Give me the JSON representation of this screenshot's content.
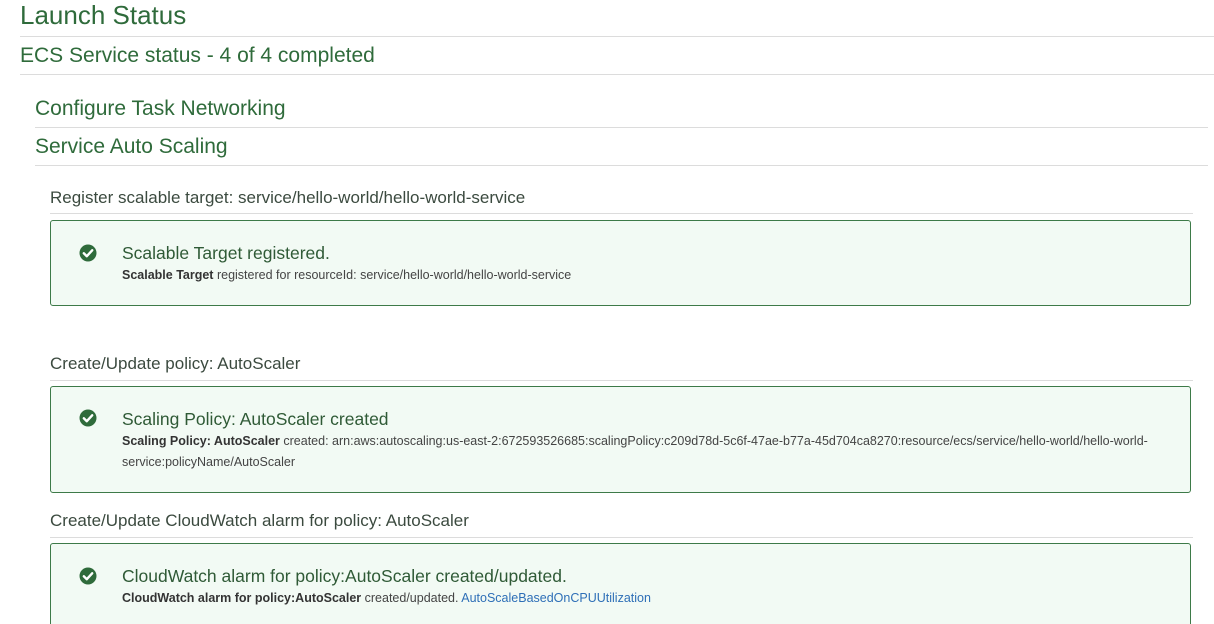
{
  "page": {
    "title": "Launch Status",
    "ecs_status": "ECS Service status - 4 of 4 completed"
  },
  "sections": {
    "configure_networking": "Configure Task Networking",
    "auto_scaling": "Service Auto Scaling"
  },
  "steps": [
    {
      "heading": "Register scalable target: service/hello-world/hello-world-service",
      "icon": "check-circle-icon",
      "title": "Scalable Target registered.",
      "detail_bold": "Scalable Target",
      "detail_text": " registered for resourceId: service/hello-world/hello-world-service"
    },
    {
      "heading": "Create/Update policy: AutoScaler",
      "icon": "check-circle-icon",
      "title": "Scaling Policy: AutoScaler created",
      "detail_bold": "Scaling Policy: AutoScaler",
      "detail_text": " created: arn:aws:autoscaling:us-east-2:672593526685:scalingPolicy:c209d78d-5c6f-47ae-b77a-45d704ca8270:resource/ecs/service/hello-world/hello-world-service:policyName/AutoScaler"
    },
    {
      "heading": "Create/Update CloudWatch alarm for policy: AutoScaler",
      "icon": "check-circle-icon",
      "title": "CloudWatch alarm for policy:AutoScaler created/updated.",
      "detail_bold": "CloudWatch alarm for policy:AutoScaler",
      "detail_text": " created/updated. ",
      "detail_link": "AutoScaleBasedOnCPUUtilization"
    }
  ],
  "colors": {
    "heading_green": "#2f6b3b",
    "success_border": "#3d7a48",
    "success_bg": "#f2faf4",
    "link_blue": "#2e6fb7"
  }
}
